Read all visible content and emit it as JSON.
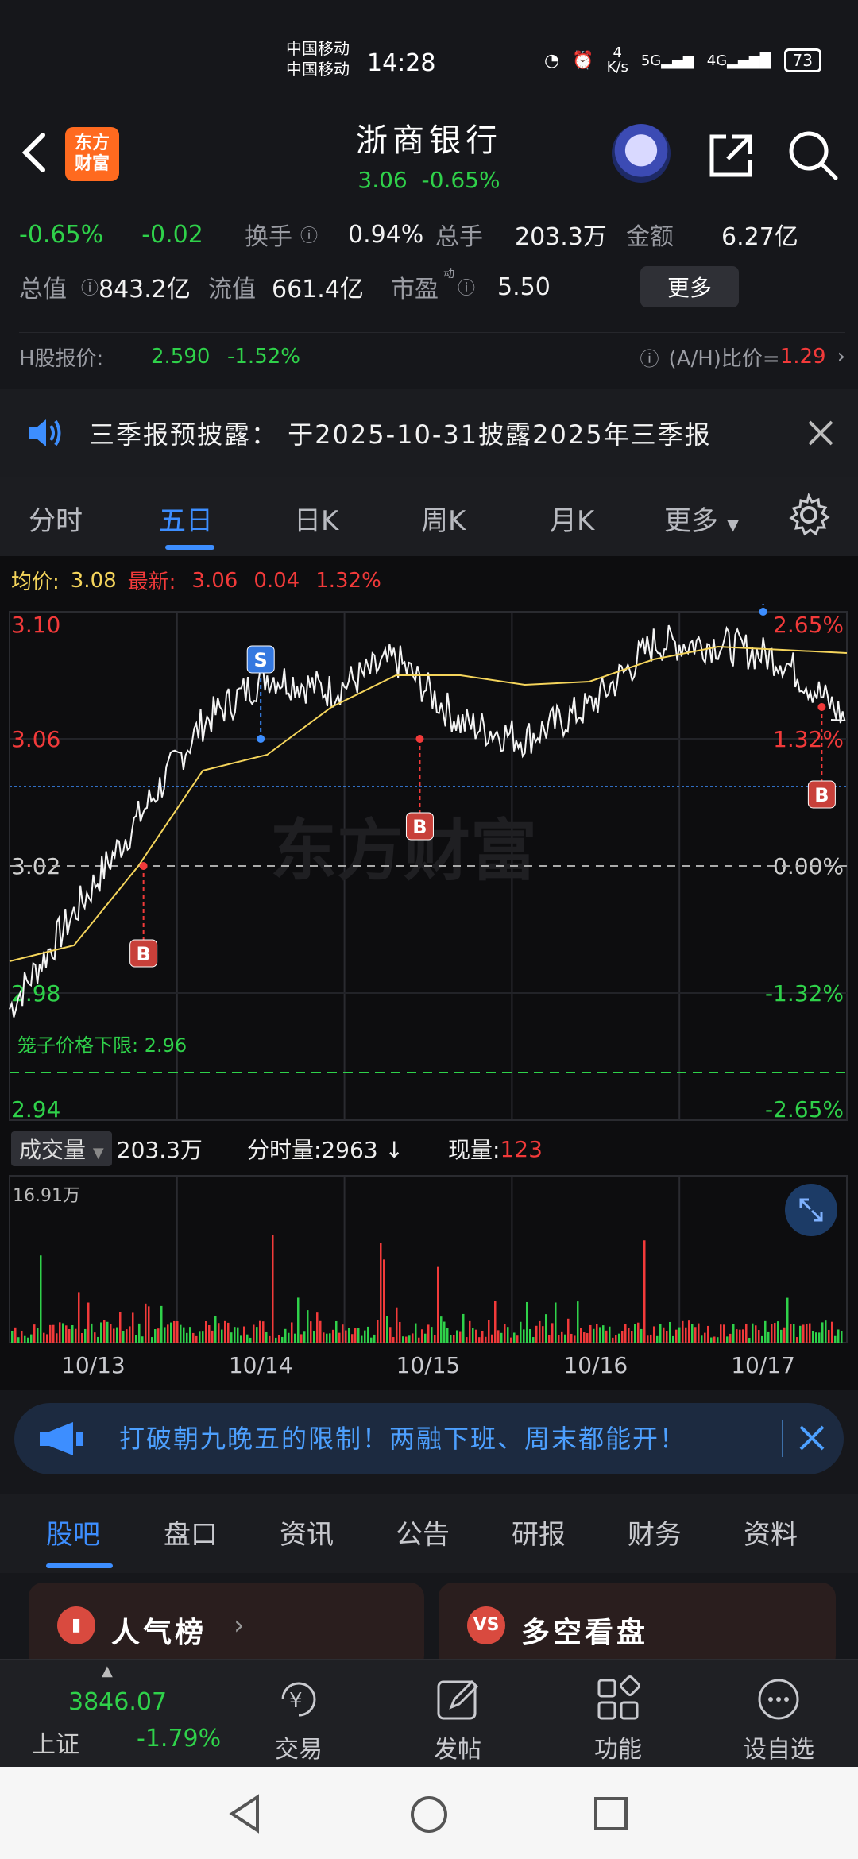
{
  "status_bar": {
    "carrier1": "中国移动",
    "carrier2": "中国移动",
    "time": "14:28",
    "net_speed_value": "4",
    "net_speed_unit": "K/s",
    "signal1": "5G",
    "signal2": "4G",
    "battery": "73"
  },
  "header": {
    "logo_line1": "东方",
    "logo_line2": "财富",
    "stock_name": "浙商银行",
    "price": "3.06",
    "change_pct": "-0.65%"
  },
  "info": {
    "chg_pct": "-0.65%",
    "chg_val": "-0.02",
    "turnover_label": "换手",
    "turnover": "0.94%",
    "total_vol_label": "总手",
    "total_vol": "203.3万",
    "amount_label": "金额",
    "amount": "6.27亿",
    "mkt_cap_label": "总值",
    "mkt_cap": "843.2亿",
    "float_cap_label": "流值",
    "float_cap": "661.4亿",
    "pe_label": "市盈",
    "pe_sup": "动",
    "pe": "5.50",
    "more": "更多"
  },
  "hshare": {
    "label": "H股报价:",
    "price": "2.590",
    "change": "-1.52%",
    "ah_label": "(A/H)比价=",
    "ah_value": "1.29"
  },
  "notice": {
    "text": "三季报预披露： 于2025-10-31披露2025年三季报"
  },
  "tabs": [
    "分时",
    "五日",
    "日K",
    "周K",
    "月K",
    "更多"
  ],
  "legend": {
    "avg_label": "均价:",
    "avg_value": "3.08",
    "latest_label": "最新:",
    "latest_value": "3.06",
    "latest_chg": "0.04",
    "latest_pct": "1.32%"
  },
  "chart_data": {
    "type": "line",
    "title": "",
    "x_labels": [
      "10/13",
      "10/14",
      "10/15",
      "10/16",
      "10/17"
    ],
    "price_ticks_left": [
      "3.10",
      "3.06",
      "3.02",
      "2.98",
      "2.94"
    ],
    "pct_ticks_right": [
      "2.65%",
      "1.32%",
      "0.00%",
      "-1.32%",
      "-2.65%"
    ],
    "ylim": [
      2.94,
      3.1
    ],
    "prev_close": 3.02,
    "limit_down_label": "笼子价格下限: 2.96",
    "limit_down_value": 2.96,
    "series": [
      {
        "values": [
          2.975,
          3.005,
          3.035,
          3.065,
          3.08,
          3.075,
          3.085,
          3.065,
          3.06,
          3.07,
          3.09,
          3.09,
          3.085,
          3.066
        ]
      },
      {
        "values": [
          2.99,
          2.995,
          3.02,
          3.05,
          3.055,
          3.07,
          3.08,
          3.08,
          3.077,
          3.078,
          3.085,
          3.089,
          3.088,
          3.087
        ]
      }
    ],
    "markers": [
      {
        "label": "B",
        "day": 0,
        "value": 3.02
      },
      {
        "label": "S",
        "day": 1,
        "value": 3.06
      },
      {
        "label": "B",
        "day": 2,
        "value": 3.06
      },
      {
        "label": "S",
        "day": 4,
        "value": 3.1
      },
      {
        "label": "B",
        "day": 4,
        "value": 3.07
      }
    ],
    "volume_max_label": "16.91万",
    "grid": true,
    "watermark": "东方财富"
  },
  "volume_bar": {
    "dropdown": "成交量",
    "total": "203.3万",
    "tick_label": "分时量:2963",
    "tick_arrow": "↓",
    "now_label": "现量:",
    "now_value": "123"
  },
  "banner": {
    "text": "打破朝九晚五的限制！两融下班、周末都能开！"
  },
  "subtabs": [
    "股吧",
    "盘口",
    "资讯",
    "公告",
    "研报",
    "财务",
    "资料"
  ],
  "cards": [
    {
      "icon": "▮",
      "title": "人气榜"
    },
    {
      "icon": "VS",
      "title": "多空看盘"
    }
  ],
  "bottom_nav": {
    "index_value": "3846.07",
    "index_name": "上证",
    "index_pct": "-1.79%",
    "items": [
      "交易",
      "发帖",
      "功能",
      "设自选"
    ]
  },
  "colors": {
    "up": "#f23a3a",
    "down": "#2fd14a",
    "accent": "#3d8eff",
    "avg_line": "#f4d45b"
  }
}
